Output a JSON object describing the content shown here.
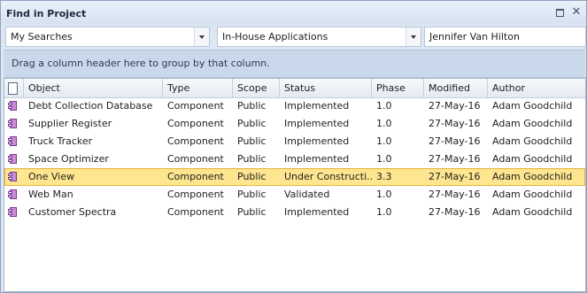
{
  "window": {
    "title": "Find in Project"
  },
  "filters": {
    "search_combo": "My Searches",
    "area_combo": "In-House Applications",
    "author_value": "Jennifer Van Hilton"
  },
  "group_hint": "Drag a column header here to group by that column.",
  "columns": [
    "Object",
    "Type",
    "Scope",
    "Status",
    "Phase",
    "Modified",
    "Author"
  ],
  "rows": [
    {
      "object": "Debt Collection Database",
      "type": "Component",
      "scope": "Public",
      "status": "Implemented",
      "phase": "1.0",
      "modified": "27-May-16",
      "author": "Adam Goodchild",
      "icon": "component-icon"
    },
    {
      "object": "Supplier Register",
      "type": "Component",
      "scope": "Public",
      "status": "Implemented",
      "phase": "1.0",
      "modified": "27-May-16",
      "author": "Adam Goodchild",
      "icon": "component-icon"
    },
    {
      "object": "Truck Tracker",
      "type": "Component",
      "scope": "Public",
      "status": "Implemented",
      "phase": "1.0",
      "modified": "27-May-16",
      "author": "Adam Goodchild",
      "icon": "component-icon"
    },
    {
      "object": "Space Optimizer",
      "type": "Component",
      "scope": "Public",
      "status": "Implemented",
      "phase": "1.0",
      "modified": "27-May-16",
      "author": "Adam Goodchild",
      "icon": "component-icon"
    },
    {
      "object": "One View",
      "type": "Component",
      "scope": "Public",
      "status": "Under Constructi...",
      "phase": "3.3",
      "modified": "27-May-16",
      "author": "Adam Goodchild",
      "icon": "component-icon",
      "selected": true
    },
    {
      "object": "Web Man",
      "type": "Component",
      "scope": "Public",
      "status": "Validated",
      "phase": "1.0",
      "modified": "27-May-16",
      "author": "Adam Goodchild",
      "icon": "component-icon"
    },
    {
      "object": "Customer Spectra",
      "type": "Component",
      "scope": "Public",
      "status": "Implemented",
      "phase": "1.0",
      "modified": "27-May-16",
      "author": "Adam Goodchild",
      "icon": "component-icon"
    }
  ],
  "colors": {
    "selected_row": "#fde68f",
    "component_icon": "#c98ed9"
  }
}
